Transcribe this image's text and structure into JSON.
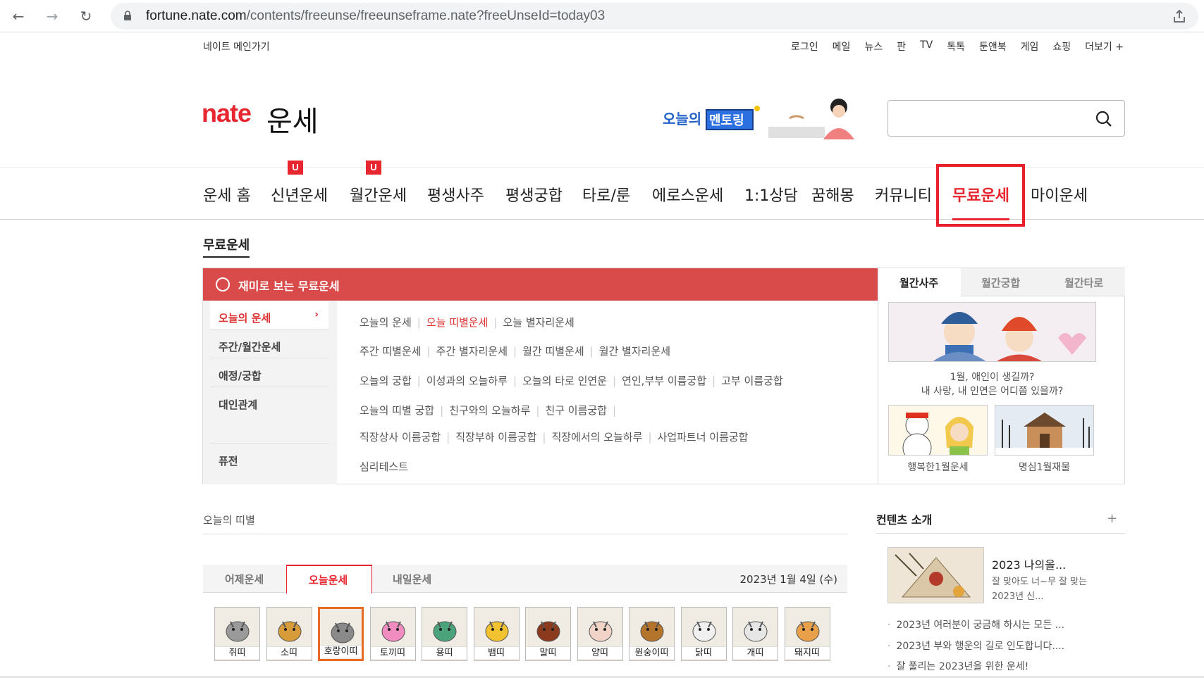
{
  "browser": {
    "url_host": "fortune.nate.com",
    "url_path": "/contents/freeunse/freeunseframe.nate?freeUnseId=today03"
  },
  "gnb": {
    "home_link": "네이트 메인가기",
    "links": [
      "로그인",
      "메일",
      "뉴스",
      "판",
      "TV",
      "톡톡",
      "툰앤북",
      "게임",
      "쇼핑",
      "더보기 +"
    ]
  },
  "logo": {
    "brand": "nate",
    "service": "운세"
  },
  "search": {
    "placeholder": ""
  },
  "main_nav": {
    "items": [
      "운세 홈",
      "신년운세",
      "월간운세",
      "평생사주",
      "평생궁합",
      "타로/룬",
      "에로스운세",
      "1:1상담",
      "꿈해몽",
      "커뮤니티",
      "무료운세",
      "마이운세"
    ],
    "badge": "U",
    "active": "무료운세"
  },
  "section_title": "무료운세",
  "panel": {
    "header": "재미로 보는 무료운세",
    "categories": [
      "오늘의 운세",
      "주간/월간운세",
      "애정/궁합",
      "대인관계",
      "퓨전"
    ],
    "rows": [
      [
        "오늘의 운세",
        "오늘 띠별운세",
        "오늘 별자리운세"
      ],
      [
        "주간 띠별운세",
        "주간 별자리운세",
        "월간 띠별운세",
        "월간 별자리운세"
      ],
      [
        "오늘의 궁합",
        "이성과의 오늘하루",
        "오늘의 타로 인연운",
        "연인,부부 이름궁합",
        "고부 이름궁합"
      ],
      [
        "오늘의 띠별 궁합",
        "친구와의 오늘하루",
        "친구 이름궁합"
      ],
      [
        "직장상사 이름궁합",
        "직장부하 이름궁합",
        "직장에서의 오늘하루",
        "사업파트너 이름궁합"
      ],
      [
        "심리테스트"
      ]
    ]
  },
  "side": {
    "tabs": [
      "월간사주",
      "월간궁합",
      "월간타로"
    ],
    "main_caption_1": "1월, 애인이 생길까?",
    "main_caption_2": "내 사랑, 내 인연은 어디쯤 있을까?",
    "small_captions": [
      "행복한1월운세",
      "명심1월재물"
    ]
  },
  "today_zodiac": {
    "title": "오늘의 띠별",
    "tabs": [
      "어제운세",
      "오늘운세",
      "내일운세"
    ],
    "date": "2023년 1월 4일 (수)",
    "animals": [
      "쥐띠",
      "소띠",
      "호랑이띠",
      "토끼띠",
      "용띠",
      "뱀띠",
      "말띠",
      "양띠",
      "원숭이띠",
      "닭띠",
      "개띠",
      "돼지띠"
    ],
    "selected": "호랑이띠"
  },
  "contents_intro": {
    "title": "컨텐츠 소개",
    "plus": "+",
    "feature_title": "2023 나의올...",
    "feature_desc_1": "잘 맞아도 너~무 잘 맞는",
    "feature_desc_2": "2023년 신...",
    "news": [
      "2023년 여러분이 궁금해 하시는 모든 ...",
      "2023년 부와 행운의 길로 인도합니다....",
      "잘 풀리는 2023년을 위한 운세!"
    ]
  },
  "colors": {
    "brand": "#e8262f",
    "panel_head": "#d94a4a",
    "highlight_box": "#e8202b",
    "selected_animal": "#e86a25"
  }
}
